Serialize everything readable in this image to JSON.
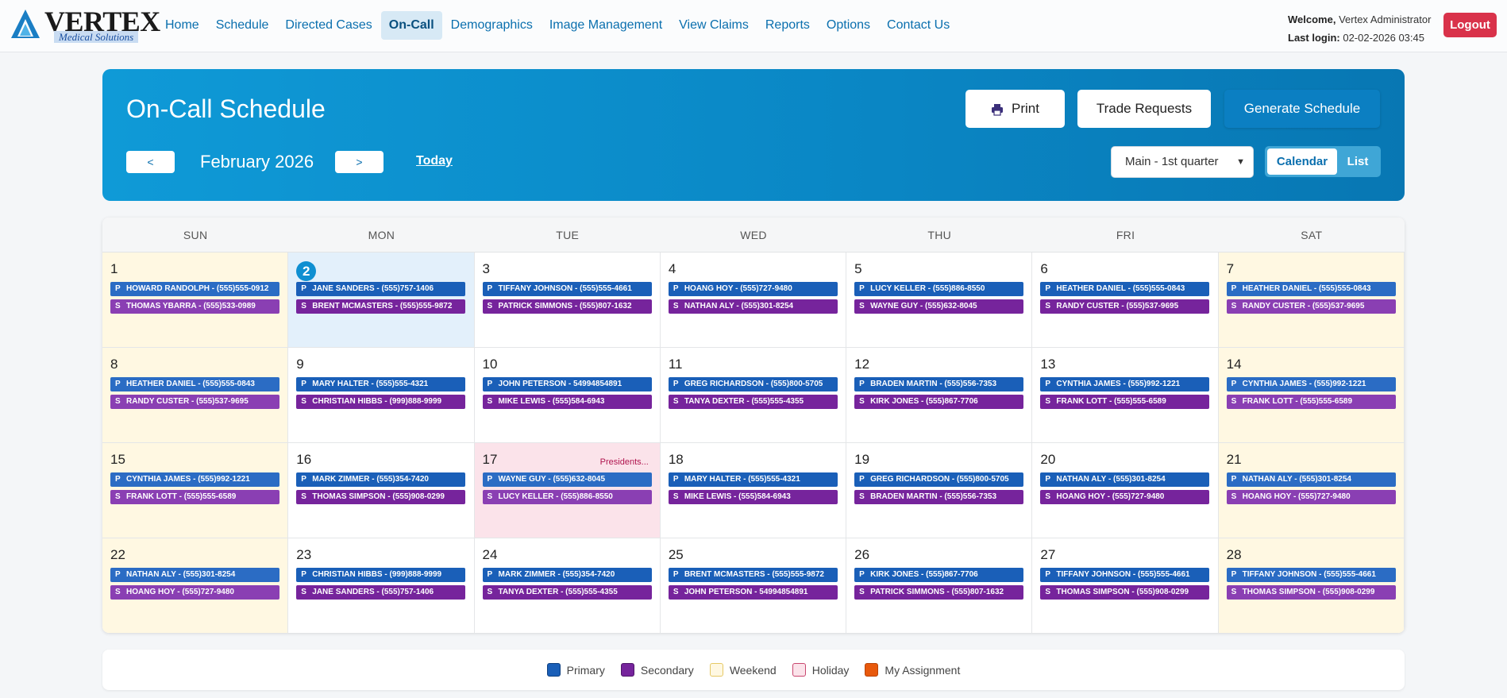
{
  "brand": {
    "name": "VERTEX",
    "tagline": "Medical Solutions"
  },
  "nav": [
    "Home",
    "Schedule",
    "Directed Cases",
    "On-Call",
    "Demographics",
    "Image Management",
    "View Claims",
    "Reports",
    "Options",
    "Contact Us"
  ],
  "nav_active": "On-Call",
  "user": {
    "welcome_label": "Welcome,",
    "name": "Vertex Administrator",
    "login_label": "Last login:",
    "login_value": "02-02-2026 03:45",
    "logout": "Logout"
  },
  "header": {
    "title": "On-Call Schedule",
    "print": "Print",
    "trade": "Trade Requests",
    "generate": "Generate Schedule",
    "prev": "<",
    "next": ">",
    "month": "February 2026",
    "today": "Today",
    "group_select": "Main - 1st quarter",
    "view_calendar": "Calendar",
    "view_list": "List"
  },
  "weekdays": [
    "SUN",
    "MON",
    "TUE",
    "WED",
    "THU",
    "FRI",
    "SAT"
  ],
  "days": [
    {
      "d": "1",
      "p": "HOWARD RANDOLPH - (555)555-0912",
      "s": "THOMAS YBARRA - (555)533-0989"
    },
    {
      "d": "2",
      "p": "JANE SANDERS - (555)757-1406",
      "s": "BRENT MCMASTERS - (555)555-9872",
      "today": true
    },
    {
      "d": "3",
      "p": "TIFFANY JOHNSON - (555)555-4661",
      "s": "PATRICK SIMMONS - (555)807-1632"
    },
    {
      "d": "4",
      "p": "HOANG HOY - (555)727-9480",
      "s": "NATHAN ALY - (555)301-8254"
    },
    {
      "d": "5",
      "p": "LUCY KELLER - (555)886-8550",
      "s": "WAYNE GUY - (555)632-8045"
    },
    {
      "d": "6",
      "p": "HEATHER DANIEL - (555)555-0843",
      "s": "RANDY CUSTER - (555)537-9695"
    },
    {
      "d": "7",
      "p": "HEATHER DANIEL - (555)555-0843",
      "s": "RANDY CUSTER - (555)537-9695"
    },
    {
      "d": "8",
      "p": "HEATHER DANIEL - (555)555-0843",
      "s": "RANDY CUSTER - (555)537-9695"
    },
    {
      "d": "9",
      "p": "MARY HALTER - (555)555-4321",
      "s": "CHRISTIAN HIBBS - (999)888-9999"
    },
    {
      "d": "10",
      "p": "JOHN PETERSON - 54994854891",
      "s": "MIKE LEWIS - (555)584-6943"
    },
    {
      "d": "11",
      "p": "GREG RICHARDSON - (555)800-5705",
      "s": "TANYA DEXTER - (555)555-4355"
    },
    {
      "d": "12",
      "p": "BRADEN MARTIN - (555)556-7353",
      "s": "KIRK JONES - (555)867-7706"
    },
    {
      "d": "13",
      "p": "CYNTHIA JAMES - (555)992-1221",
      "s": "FRANK LOTT - (555)555-6589"
    },
    {
      "d": "14",
      "p": "CYNTHIA JAMES - (555)992-1221",
      "s": "FRANK LOTT - (555)555-6589"
    },
    {
      "d": "15",
      "p": "CYNTHIA JAMES - (555)992-1221",
      "s": "FRANK LOTT - (555)555-6589"
    },
    {
      "d": "16",
      "p": "MARK ZIMMER - (555)354-7420",
      "s": "THOMAS SIMPSON - (555)908-0299"
    },
    {
      "d": "17",
      "p": "WAYNE GUY - (555)632-8045",
      "s": "LUCY KELLER - (555)886-8550",
      "holiday": "Presidents..."
    },
    {
      "d": "18",
      "p": "MARY HALTER - (555)555-4321",
      "s": "MIKE LEWIS - (555)584-6943"
    },
    {
      "d": "19",
      "p": "GREG RICHARDSON - (555)800-5705",
      "s": "BRADEN MARTIN - (555)556-7353"
    },
    {
      "d": "20",
      "p": "NATHAN ALY - (555)301-8254",
      "s": "HOANG HOY - (555)727-9480"
    },
    {
      "d": "21",
      "p": "NATHAN ALY - (555)301-8254",
      "s": "HOANG HOY - (555)727-9480"
    },
    {
      "d": "22",
      "p": "NATHAN ALY - (555)301-8254",
      "s": "HOANG HOY - (555)727-9480"
    },
    {
      "d": "23",
      "p": "CHRISTIAN HIBBS - (999)888-9999",
      "s": "JANE SANDERS - (555)757-1406"
    },
    {
      "d": "24",
      "p": "MARK ZIMMER - (555)354-7420",
      "s": "TANYA DEXTER - (555)555-4355"
    },
    {
      "d": "25",
      "p": "BRENT MCMASTERS - (555)555-9872",
      "s": "JOHN PETERSON - 54994854891"
    },
    {
      "d": "26",
      "p": "KIRK JONES - (555)867-7706",
      "s": "PATRICK SIMMONS - (555)807-1632"
    },
    {
      "d": "27",
      "p": "TIFFANY JOHNSON - (555)555-4661",
      "s": "THOMAS SIMPSON - (555)908-0299"
    },
    {
      "d": "28",
      "p": "TIFFANY JOHNSON - (555)555-4661",
      "s": "THOMAS SIMPSON - (555)908-0299"
    }
  ],
  "shift_tags": {
    "primary": "P",
    "secondary": "S"
  },
  "legend": [
    {
      "label": "Primary",
      "color": "#1a5fb8",
      "border": "#0d3f80"
    },
    {
      "label": "Secondary",
      "color": "#76249c",
      "border": "#4e1569"
    },
    {
      "label": "Weekend",
      "color": "#fff8e2",
      "border": "#e6c965"
    },
    {
      "label": "Holiday",
      "color": "#fbe3ea",
      "border": "#c9476f"
    },
    {
      "label": "My Assignment",
      "color": "#e8590c",
      "border": "#b84307"
    }
  ]
}
